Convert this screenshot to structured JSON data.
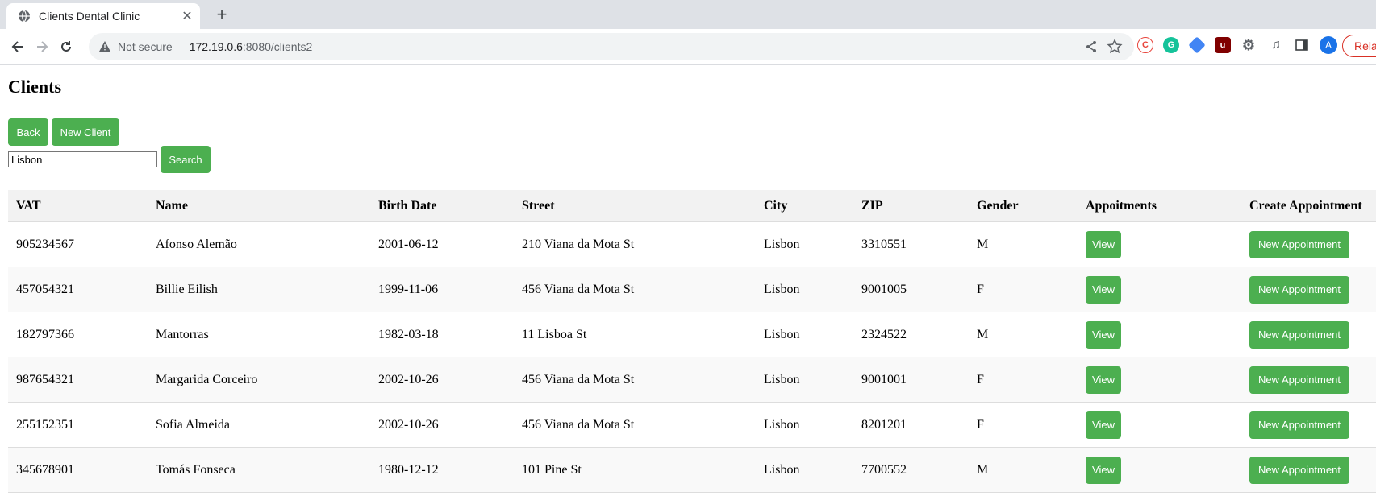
{
  "browser": {
    "tab_title": "Clients Dental Clinic",
    "url_security": "Not secure",
    "url_host": "172.19.0.6",
    "url_path": ":8080/clients2",
    "relaunch_label": "Rela",
    "avatar_letter": "A"
  },
  "page": {
    "title": "Clients",
    "back_label": "Back",
    "new_client_label": "New Client",
    "search_value": "Lisbon",
    "search_label": "Search"
  },
  "table": {
    "headers": [
      "VAT",
      "Name",
      "Birth Date",
      "Street",
      "City",
      "ZIP",
      "Gender",
      "Appoitments",
      "Create Appointment"
    ],
    "view_label": "View",
    "new_appointment_label": "New Appointment",
    "rows": [
      {
        "vat": "905234567",
        "name": "Afonso Alemão",
        "birth": "2001-06-12",
        "street": "210 Viana da Mota St",
        "city": "Lisbon",
        "zip": "3310551",
        "gender": "M"
      },
      {
        "vat": "457054321",
        "name": "Billie Eilish",
        "birth": "1999-11-06",
        "street": "456 Viana da Mota St",
        "city": "Lisbon",
        "zip": "9001005",
        "gender": "F"
      },
      {
        "vat": "182797366",
        "name": "Mantorras",
        "birth": "1982-03-18",
        "street": "11 Lisboa St",
        "city": "Lisbon",
        "zip": "2324522",
        "gender": "M"
      },
      {
        "vat": "987654321",
        "name": "Margarida Corceiro",
        "birth": "2002-10-26",
        "street": "456 Viana da Mota St",
        "city": "Lisbon",
        "zip": "9001001",
        "gender": "F"
      },
      {
        "vat": "255152351",
        "name": "Sofia Almeida",
        "birth": "2002-10-26",
        "street": "456 Viana da Mota St",
        "city": "Lisbon",
        "zip": "8201201",
        "gender": "F"
      },
      {
        "vat": "345678901",
        "name": "Tomás Fonseca",
        "birth": "1980-12-12",
        "street": "101 Pine St",
        "city": "Lisbon",
        "zip": "7700552",
        "gender": "M"
      }
    ]
  },
  "colors": {
    "accent": "#4caf50"
  }
}
